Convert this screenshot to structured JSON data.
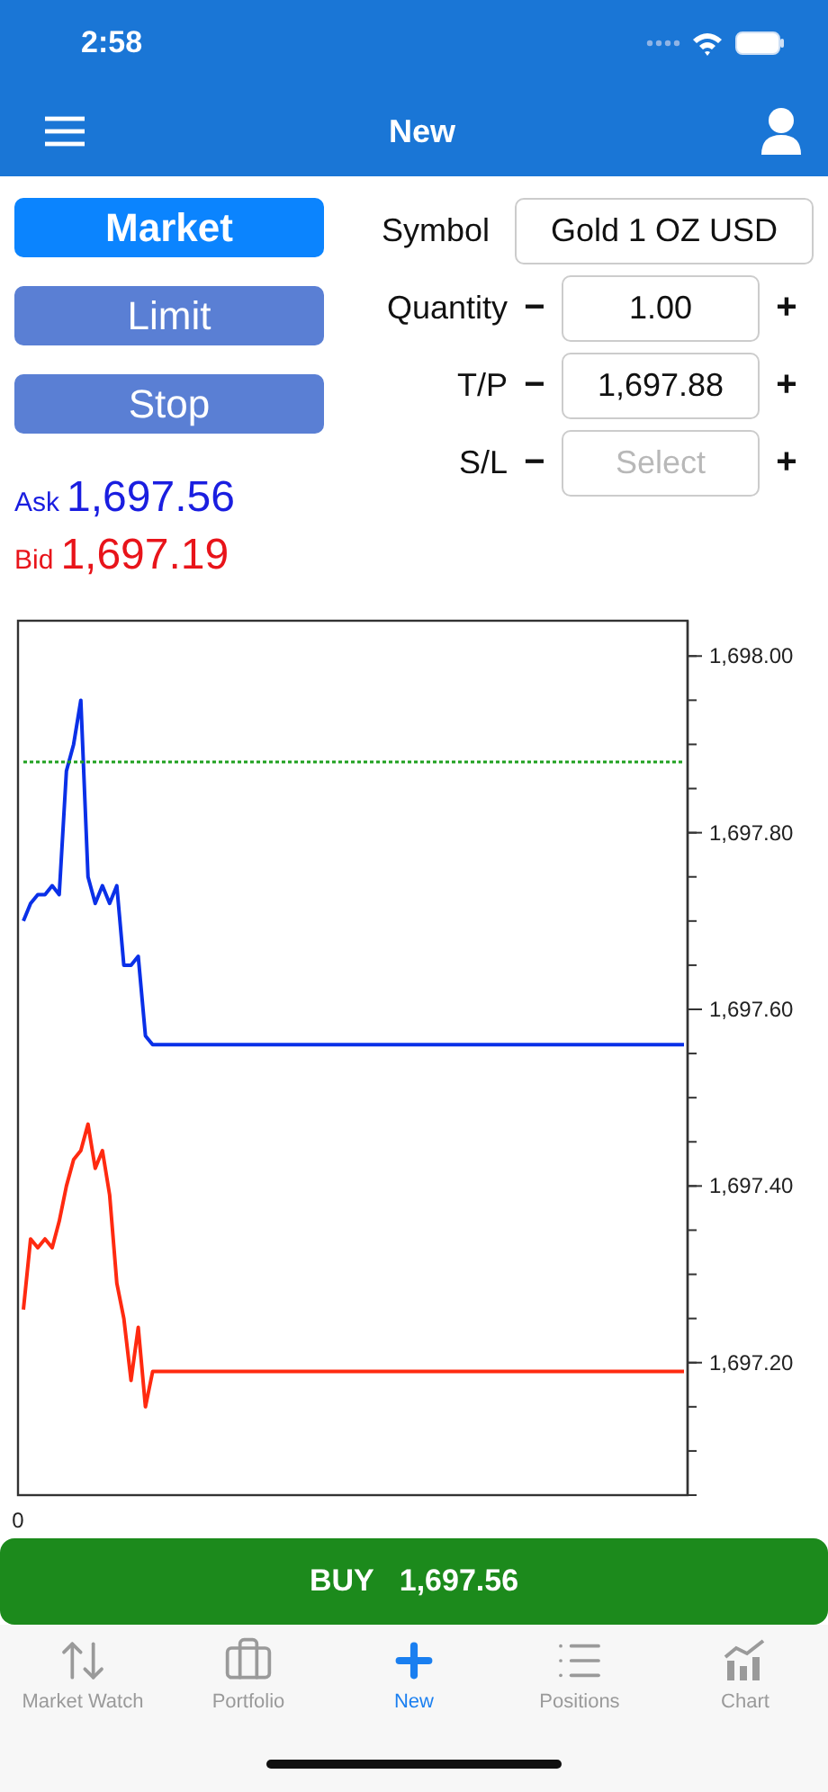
{
  "status_bar": {
    "time": "2:58"
  },
  "nav_bar": {
    "title": "New"
  },
  "order_types": [
    {
      "label": "Market",
      "selected": true
    },
    {
      "label": "Limit",
      "selected": false
    },
    {
      "label": "Stop",
      "selected": false
    }
  ],
  "fields": [
    {
      "kind": "picker",
      "label": "Symbol",
      "value": "Gold 1 OZ USD"
    },
    {
      "kind": "stepper",
      "label": "Quantity",
      "minus": "−",
      "value": "1.00",
      "plus": "+"
    },
    {
      "kind": "stepper",
      "label": "T/P",
      "minus": "−",
      "value": "1,697.88",
      "plus": "+"
    },
    {
      "kind": "stepper",
      "label": "S/L",
      "minus": "−",
      "placeholder": "Select",
      "plus": "+"
    }
  ],
  "quotes": [
    {
      "label": "Ask",
      "price": "1,697.56",
      "color": "#1a1ee0"
    },
    {
      "label": "Bid",
      "price": "1,697.19",
      "color": "#e8141a"
    }
  ],
  "chart": {
    "chart_data": {
      "type": "line",
      "series": [
        {
          "color": "#0a30e8",
          "values": [
            1697.7,
            1697.72,
            1697.73,
            1697.73,
            1697.74,
            1697.73,
            1697.87,
            1697.9,
            1697.95,
            1697.75,
            1697.72,
            1697.74,
            1697.72,
            1697.74,
            1697.65,
            1697.65,
            1697.66,
            1697.57,
            1697.56,
            1697.56,
            1697.56,
            1697.56,
            1697.56,
            1697.56,
            1697.56,
            1697.56,
            1697.56,
            1697.56,
            1697.56,
            1697.56,
            1697.56,
            1697.56,
            1697.56,
            1697.56,
            1697.56,
            1697.56,
            1697.56,
            1697.56,
            1697.56,
            1697.56,
            1697.56,
            1697.56,
            1697.56,
            1697.56,
            1697.56,
            1697.56,
            1697.56,
            1697.56,
            1697.56,
            1697.56,
            1697.56,
            1697.56,
            1697.56,
            1697.56,
            1697.56,
            1697.56,
            1697.56,
            1697.56,
            1697.56,
            1697.56,
            1697.56,
            1697.56,
            1697.56,
            1697.56,
            1697.56,
            1697.56,
            1697.56,
            1697.56,
            1697.56,
            1697.56,
            1697.56,
            1697.56,
            1697.56,
            1697.56,
            1697.56,
            1697.56,
            1697.56,
            1697.56,
            1697.56,
            1697.56,
            1697.56,
            1697.56,
            1697.56,
            1697.56,
            1697.56,
            1697.56,
            1697.56,
            1697.56,
            1697.56,
            1697.56,
            1697.56,
            1697.56,
            1697.56
          ]
        },
        {
          "color": "#ff2a10",
          "values": [
            1697.26,
            1697.34,
            1697.33,
            1697.34,
            1697.33,
            1697.36,
            1697.4,
            1697.43,
            1697.44,
            1697.47,
            1697.42,
            1697.44,
            1697.39,
            1697.29,
            1697.25,
            1697.18,
            1697.24,
            1697.15,
            1697.19,
            1697.19,
            1697.19,
            1697.19,
            1697.19,
            1697.19,
            1697.19,
            1697.19,
            1697.19,
            1697.19,
            1697.19,
            1697.19,
            1697.19,
            1697.19,
            1697.19,
            1697.19,
            1697.19,
            1697.19,
            1697.19,
            1697.19,
            1697.19,
            1697.19,
            1697.19,
            1697.19,
            1697.19,
            1697.19,
            1697.19,
            1697.19,
            1697.19,
            1697.19,
            1697.19,
            1697.19,
            1697.19,
            1697.19,
            1697.19,
            1697.19,
            1697.19,
            1697.19,
            1697.19,
            1697.19,
            1697.19,
            1697.19,
            1697.19,
            1697.19,
            1697.19,
            1697.19,
            1697.19,
            1697.19,
            1697.19,
            1697.19,
            1697.19,
            1697.19,
            1697.19,
            1697.19,
            1697.19,
            1697.19,
            1697.19,
            1697.19,
            1697.19,
            1697.19,
            1697.19,
            1697.19,
            1697.19,
            1697.19,
            1697.19,
            1697.19,
            1697.19,
            1697.19,
            1697.19,
            1697.19,
            1697.19,
            1697.19,
            1697.19,
            1697.19,
            1697.19
          ]
        },
        {
          "color": "#1fa01f",
          "line_style": "dashed",
          "values": [
            1697.88,
            1697.88,
            1697.88,
            1697.88,
            1697.88,
            1697.88,
            1697.88,
            1697.88,
            1697.88,
            1697.88,
            1697.88,
            1697.88,
            1697.88,
            1697.88,
            1697.88,
            1697.88,
            1697.88,
            1697.88,
            1697.88,
            1697.88,
            1697.88,
            1697.88,
            1697.88,
            1697.88,
            1697.88,
            1697.88,
            1697.88,
            1697.88,
            1697.88,
            1697.88,
            1697.88,
            1697.88,
            1697.88,
            1697.88,
            1697.88,
            1697.88,
            1697.88,
            1697.88,
            1697.88,
            1697.88,
            1697.88,
            1697.88,
            1697.88,
            1697.88,
            1697.88,
            1697.88,
            1697.88,
            1697.88,
            1697.88,
            1697.88,
            1697.88,
            1697.88,
            1697.88,
            1697.88,
            1697.88,
            1697.88,
            1697.88,
            1697.88,
            1697.88,
            1697.88,
            1697.88,
            1697.88,
            1697.88,
            1697.88,
            1697.88,
            1697.88,
            1697.88,
            1697.88,
            1697.88,
            1697.88,
            1697.88,
            1697.88,
            1697.88,
            1697.88,
            1697.88,
            1697.88,
            1697.88,
            1697.88,
            1697.88,
            1697.88,
            1697.88,
            1697.88,
            1697.88,
            1697.88,
            1697.88,
            1697.88,
            1697.88,
            1697.88,
            1697.88,
            1697.88,
            1697.88,
            1697.88,
            1697.88
          ]
        }
      ],
      "ylim": [
        1697.05,
        1698.04
      ],
      "yticks": [
        {
          "value": 1697.2,
          "label": "1,697.20"
        },
        {
          "value": 1697.4,
          "label": "1,697.40"
        },
        {
          "value": 1697.6,
          "label": "1,697.60"
        },
        {
          "value": 1697.8,
          "label": "1,697.80"
        },
        {
          "value": 1698.0,
          "label": "1,698.00"
        }
      ],
      "annotations": [
        {
          "text": "0"
        }
      ]
    }
  },
  "buy_button": {
    "label": "BUY",
    "price": "1,697.56"
  },
  "tabs": [
    {
      "label": "Market Watch",
      "selected": false
    },
    {
      "label": "Portfolio",
      "selected": false
    },
    {
      "label": "New",
      "selected": true
    },
    {
      "label": "Positions",
      "selected": false
    },
    {
      "label": "Chart",
      "selected": false
    }
  ]
}
